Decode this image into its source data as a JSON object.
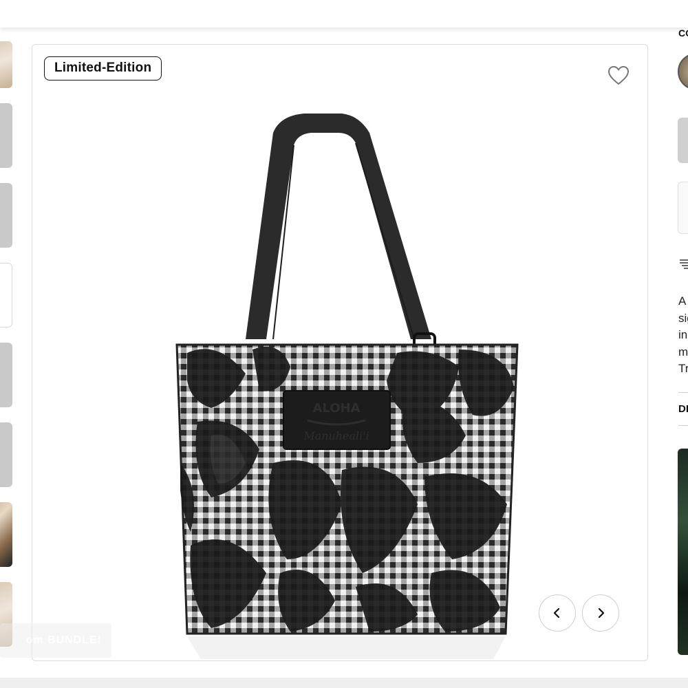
{
  "badge": {
    "label": "Limited-Edition"
  },
  "product": {
    "logo_top": "ALOHA",
    "logo_bottom": "Manuheali'i"
  },
  "bundle": {
    "label": "om BUNDLE!"
  },
  "side": {
    "section_label": "CO",
    "description_lines": [
      "A",
      "sig",
      "in",
      "m",
      "Tr"
    ],
    "details_label": "DE"
  },
  "colors": {
    "strap": "#2b2b2b",
    "bag_dark": "#1a1a1a",
    "gingham_light": "#f2f2f2",
    "border": "#dcdcdc"
  },
  "icons": {
    "wishlist": "heart-outline-icon",
    "prev": "chevron-left-icon",
    "next": "chevron-right-icon",
    "shipping": "fast-shipping-icon"
  }
}
